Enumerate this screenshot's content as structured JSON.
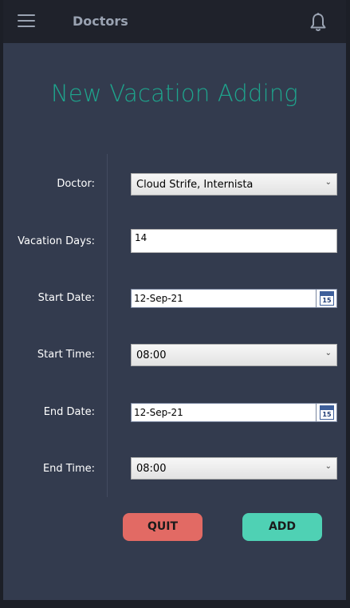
{
  "header": {
    "title": "Doctors",
    "menu_icon": "hamburger-menu-icon",
    "notification_icon": "bell-icon"
  },
  "page": {
    "title": "New Vacation Adding"
  },
  "form": {
    "doctor": {
      "label": "Doctor:",
      "value": "Cloud Strife, Internista"
    },
    "vacation_days": {
      "label": "Vacation Days:",
      "value": "14"
    },
    "start_date": {
      "label": "Start Date:",
      "value": "12-Sep-21",
      "calendar_day": "15"
    },
    "start_time": {
      "label": "Start Time:",
      "value": "08:00"
    },
    "end_date": {
      "label": "End Date:",
      "value": "12-Sep-21",
      "calendar_day": "15"
    },
    "end_time": {
      "label": "End Time:",
      "value": "08:00"
    }
  },
  "actions": {
    "quit_label": "QUIT",
    "add_label": "ADD"
  },
  "colors": {
    "title_accent": "#1ea58d",
    "quit": "#e26a64",
    "add": "#4fd1b4",
    "panel": "#333b4e",
    "topbar": "#1f222b"
  }
}
